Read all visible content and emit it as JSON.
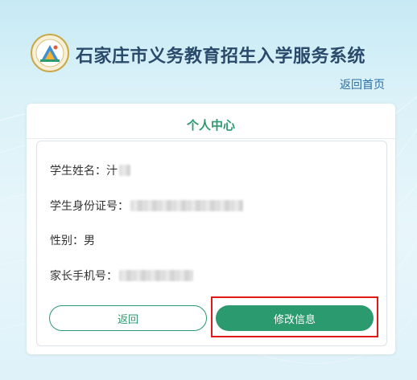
{
  "header": {
    "title": "石家庄市义务教育招生入学服务系统",
    "back_home": "返回首页",
    "logo_icon": "school-emblem-icon"
  },
  "card": {
    "title": "个人中心",
    "fields": [
      {
        "label": "学生姓名：",
        "value": "汁",
        "redacted": true
      },
      {
        "label": "学生身份证号：",
        "value": "",
        "redacted": true
      },
      {
        "label": "性别：",
        "value": "男",
        "redacted": false
      },
      {
        "label": "家长手机号：",
        "value": "",
        "redacted": true
      }
    ],
    "back_button": "返回",
    "edit_button": "修改信息"
  },
  "colors": {
    "accent": "#2b9a6f",
    "title": "#2a4a6b",
    "highlight": "#e01919"
  }
}
